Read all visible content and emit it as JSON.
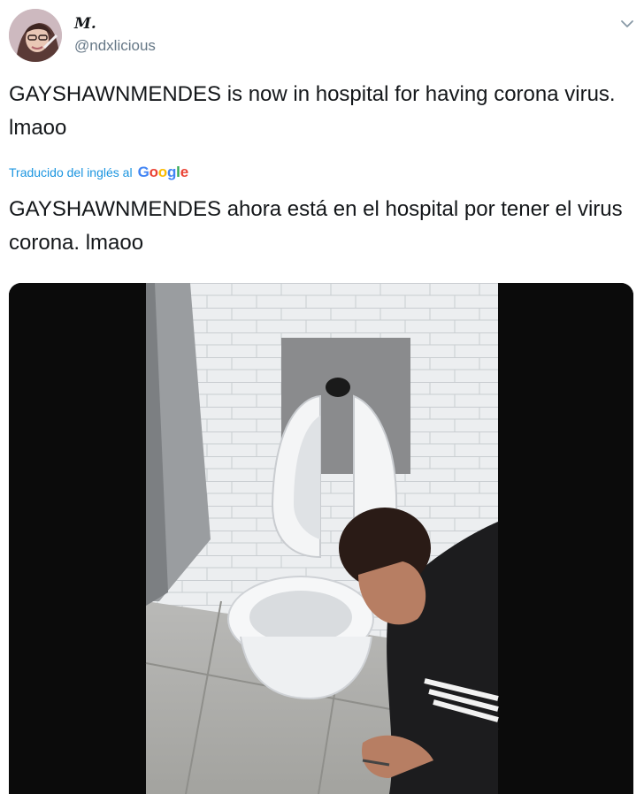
{
  "tweet": {
    "display_name": "M.",
    "handle": "@ndxlicious",
    "text": "GAYSHAWNMENDES is now in hospital for having corona virus. lmaoo",
    "translation_label": "Traducido del inglés al",
    "translation_provider": "Google",
    "translated_text": "GAYSHAWNMENDES ahora está en el hospital por tener el virus corona. lmaoo"
  },
  "icons": {
    "caret": "chevron-down-icon",
    "avatar": "avatar-image"
  },
  "colors": {
    "link": "#1b95e0",
    "secondary_text": "#657786",
    "primary_text": "#14171a",
    "video_letterbox": "#0b0b0b"
  }
}
